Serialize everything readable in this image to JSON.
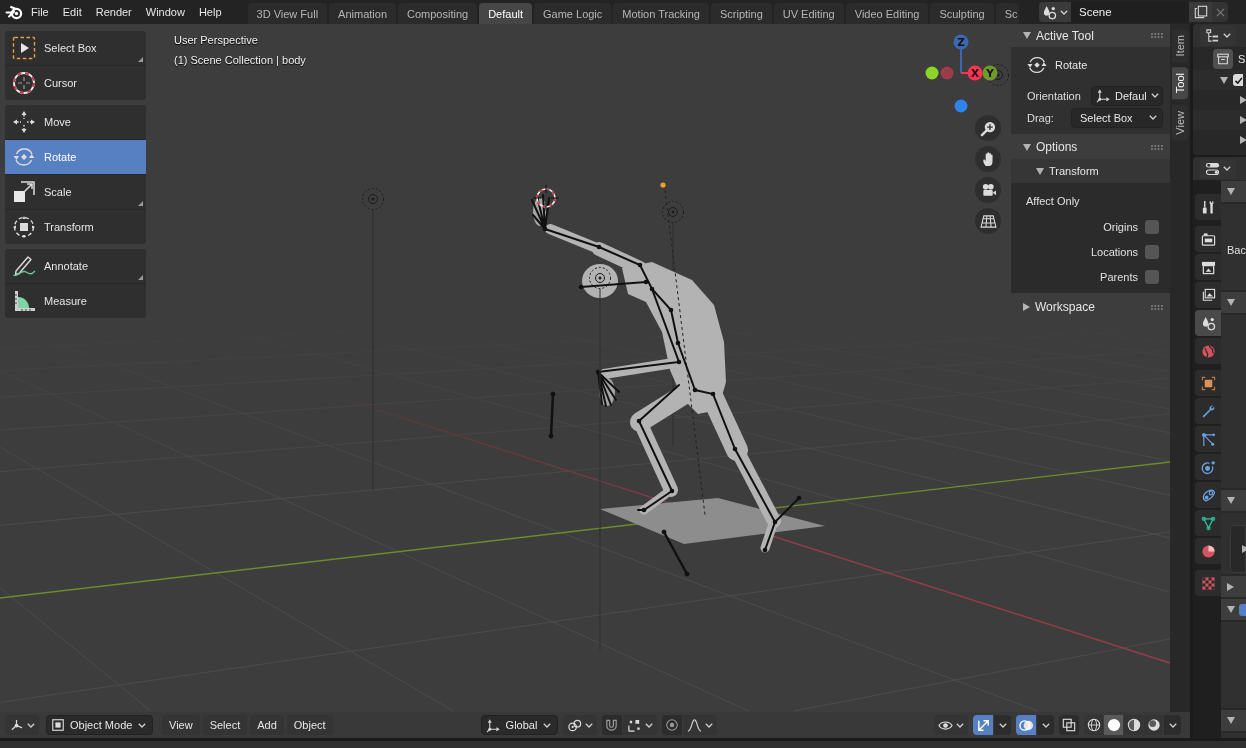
{
  "top_bar": {
    "menus": [
      "File",
      "Edit",
      "Render",
      "Window",
      "Help"
    ],
    "workspaces": [
      {
        "label": "3D View Full",
        "selected": false
      },
      {
        "label": "Animation",
        "selected": false
      },
      {
        "label": "Compositing",
        "selected": false
      },
      {
        "label": "Default",
        "selected": true
      },
      {
        "label": "Game Logic",
        "selected": false
      },
      {
        "label": "Motion Tracking",
        "selected": false
      },
      {
        "label": "Scripting",
        "selected": false
      },
      {
        "label": "UV Editing",
        "selected": false
      },
      {
        "label": "Video Editing",
        "selected": false
      },
      {
        "label": "Sculpting",
        "selected": false
      },
      {
        "label": "Sc",
        "selected": false
      }
    ],
    "scene": {
      "value": "Scene"
    }
  },
  "viewport": {
    "toolbar": [
      [
        {
          "label": "Select Box",
          "selected": false,
          "variants": true
        },
        {
          "label": "Cursor",
          "selected": false,
          "variants": false
        }
      ],
      [
        {
          "label": "Move",
          "selected": false,
          "variants": false
        },
        {
          "label": "Rotate",
          "selected": true,
          "variants": false
        },
        {
          "label": "Scale",
          "selected": false,
          "variants": true
        },
        {
          "label": "Transform",
          "selected": false,
          "variants": false
        }
      ],
      [
        {
          "label": "Annotate",
          "selected": false,
          "variants": true
        },
        {
          "label": "Measure",
          "selected": false,
          "variants": false
        }
      ]
    ],
    "info": [
      "User Perspective",
      "(1) Scene Collection | body"
    ],
    "gizmo_axes": [
      "Z",
      "X",
      "Y"
    ],
    "sidebar": {
      "tabs": [
        {
          "label": "Item",
          "selected": false
        },
        {
          "label": "Tool",
          "selected": true
        },
        {
          "label": "View",
          "selected": false
        }
      ],
      "active_tool": {
        "title": "Active Tool",
        "expanded": true,
        "tool": "Rotate",
        "orientation": {
          "label": "Orientation",
          "value": "Defaul"
        },
        "drag": {
          "label": "Drag:",
          "value": "Select Box"
        }
      },
      "options": {
        "title": "Options",
        "expanded": true,
        "transform": {
          "title": "Transform",
          "expanded": true,
          "heading": "Affect Only",
          "checkboxes": [
            {
              "label": "Origins",
              "checked": false
            },
            {
              "label": "Locations",
              "checked": false
            },
            {
              "label": "Parents",
              "checked": false
            }
          ]
        }
      },
      "workspace": {
        "title": "Workspace",
        "expanded": false
      }
    },
    "header": {
      "mode": "Object Mode",
      "menus": [
        "View",
        "Select",
        "Add",
        "Object"
      ],
      "orientation": "Global",
      "snap": {
        "on": false
      },
      "proportional_editing": {
        "on": false
      },
      "gizmos": {
        "on": true
      },
      "overlays": {
        "on": true
      },
      "xray": {
        "on": false
      },
      "shading": [
        {
          "selected": false
        },
        {
          "selected": true
        },
        {
          "selected": false
        },
        {
          "selected": false
        }
      ]
    }
  },
  "outliner": {
    "items": [
      {
        "label": "S",
        "children": [
          {
            "expanded": true,
            "checked": true,
            "children": [
              {
                "expanded": false
              },
              {
                "expanded": false
              },
              {
                "expanded": false
              }
            ]
          }
        ]
      }
    ]
  },
  "properties": {
    "tab_groups": [
      [
        {
          "selected": false
        }
      ],
      [
        {
          "selected": false
        },
        {
          "selected": false
        },
        {
          "selected": false
        },
        {
          "selected": true
        },
        {
          "selected": false
        }
      ],
      [
        {
          "selected": false
        },
        {
          "selected": false
        },
        {
          "selected": false
        },
        {
          "selected": false
        },
        {
          "selected": false
        },
        {
          "selected": false
        },
        {
          "selected": false
        }
      ],
      [
        {
          "selected": false
        }
      ]
    ],
    "panels": [
      {
        "expanded": true,
        "label": "Bac"
      },
      {
        "expanded": true
      },
      {
        "expanded": true,
        "inner_expanded": false
      },
      {
        "expanded": false
      },
      {
        "expanded": true,
        "checked": true
      },
      {
        "expanded": true
      }
    ]
  }
}
